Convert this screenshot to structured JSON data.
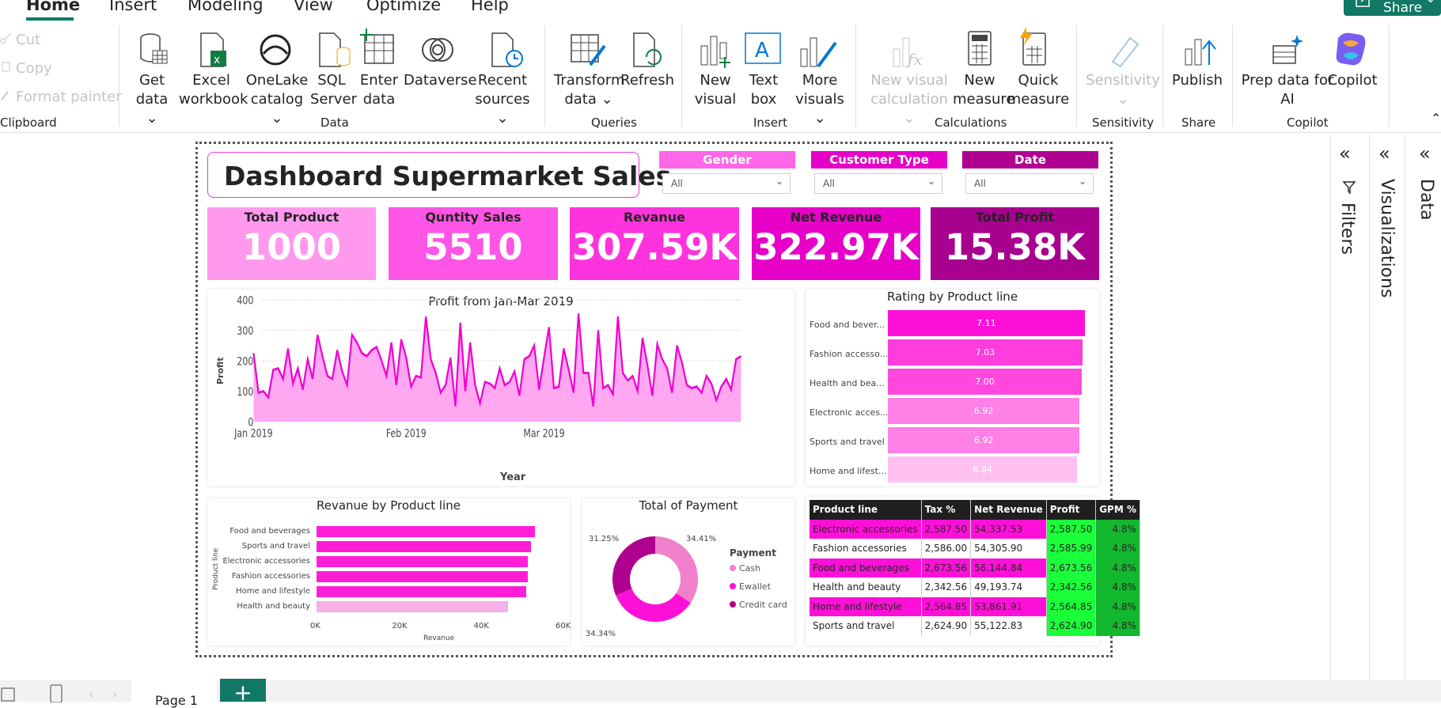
{
  "ribbon": {
    "tabs": [
      "Home",
      "Insert",
      "Modeling",
      "View",
      "Optimize",
      "Help"
    ],
    "share": "Share",
    "clipboard": {
      "cut": "Cut",
      "copy": "Copy",
      "format_painter": "Format painter",
      "group": "Clipboard"
    },
    "data_group": {
      "get_data": "Get",
      "get_data2": "data",
      "excel": "Excel",
      "excel2": "workbook",
      "onelake": "OneLake",
      "onelake2": "catalog",
      "sql": "SQL",
      "sql2": "Server",
      "enter": "Enter",
      "enter2": "data",
      "dataverse": "Dataverse",
      "recent": "Recent",
      "recent2": "sources",
      "group": "Data"
    },
    "queries": {
      "transform": "Transform",
      "transform2": "data",
      "refresh": "Refresh",
      "group": "Queries"
    },
    "insert": {
      "new_visual": "New",
      "new_visual2": "visual",
      "text_box": "Text",
      "text_box2": "box",
      "more_visuals": "More",
      "more_visuals2": "visuals",
      "group": "Insert"
    },
    "calc": {
      "new_visual_calc": "New visual",
      "new_visual_calc2": "calculation",
      "new_measure": "New",
      "new_measure2": "measure",
      "quick_measure": "Quick",
      "quick_measure2": "measure",
      "group": "Calculations"
    },
    "sensitivity": {
      "label": "Sensitivity",
      "group": "Sensitivity"
    },
    "share_group": {
      "publish": "Publish",
      "group": "Share"
    },
    "copilot": {
      "prep": "Prep data for",
      "prep2": "AI",
      "copilot": "Copilot",
      "group": "Copilot"
    }
  },
  "panes": {
    "filters": "Filters",
    "visualizations": "Visualizations",
    "data": "Data"
  },
  "page_tab": "Page 1",
  "dashboard": {
    "title": "Dashboard Supermarket Sales",
    "slicers": [
      {
        "label": "Gender",
        "value": "All"
      },
      {
        "label": "Customer Type",
        "value": "All"
      },
      {
        "label": "Date",
        "value": "All"
      }
    ],
    "kpis": [
      {
        "label": "Total Product",
        "value": "1000",
        "color": "#ff99ee"
      },
      {
        "label": "Quntity Sales",
        "value": "5510",
        "color": "#ff55e6"
      },
      {
        "label": "Revanue",
        "value": "307.59K",
        "color": "#ff33dd"
      },
      {
        "label": "Net Revenue",
        "value": "322.97K",
        "color": "#e600c8"
      },
      {
        "label": "Total Profit",
        "value": "15.38K",
        "color": "#a8008f"
      }
    ]
  },
  "chart_data": [
    {
      "type": "area",
      "title": "Profit from Jan-Mar 2019",
      "xlabel": "Year",
      "ylabel": "Profit",
      "ylim": [
        0,
        400
      ],
      "yticks": [
        "0",
        "100",
        "200",
        "300",
        "400"
      ],
      "xticks": [
        "Jan 2019",
        "Feb 2019",
        "Mar 2019"
      ],
      "values": [
        225,
        95,
        100,
        80,
        170,
        175,
        140,
        240,
        125,
        175,
        105,
        205,
        140,
        285,
        215,
        150,
        140,
        235,
        165,
        120,
        285,
        260,
        225,
        215,
        235,
        245,
        200,
        150,
        260,
        120,
        270,
        210,
        115,
        150,
        145,
        345,
        205,
        160,
        95,
        120,
        210,
        50,
        325,
        100,
        260,
        120,
        60,
        130,
        125,
        110,
        175,
        120,
        130,
        165,
        85,
        205,
        215,
        250,
        105,
        210,
        310,
        110,
        115,
        240,
        170,
        95,
        355,
        160,
        160,
        50,
        300,
        110,
        120,
        90,
        345,
        160,
        135,
        150,
        100,
        275,
        185,
        85,
        255,
        205,
        175,
        95,
        250,
        195,
        120,
        110,
        115,
        95,
        150,
        125,
        70,
        115,
        140,
        105,
        205,
        215
      ]
    },
    {
      "type": "bar",
      "title": "Rating by Product line",
      "categories": [
        "Food and bever...",
        "Fashion accesso...",
        "Health and bea...",
        "Electronic acces...",
        "Sports and travel",
        "Home and lifest..."
      ],
      "values": [
        7.11,
        7.03,
        7.0,
        6.92,
        6.92,
        6.84
      ],
      "labels": [
        "7.11",
        "7.03",
        "7.00",
        "6.92",
        "6.92",
        "6.84"
      ],
      "colors": [
        "#ff10d8",
        "#ff3cdc",
        "#ff48de",
        "#ff80e6",
        "#ff80e6",
        "#ffc0f0"
      ]
    },
    {
      "type": "bar",
      "title": "Revanue by Product line",
      "xlabel": "Revanue",
      "ylabel": "Product line",
      "categories": [
        "Food and beverages",
        "Sports and travel",
        "Electronic accessories",
        "Fashion accessories",
        "Home and lifestyle",
        "Health and beauty"
      ],
      "values": [
        53471,
        52497,
        51750,
        51719,
        51297,
        46851
      ],
      "xticks": [
        "0K",
        "20K",
        "40K",
        "60K"
      ],
      "xlim": [
        0,
        60000
      ],
      "colors": [
        "#ff1ed8",
        "#ff1ed8",
        "#ff1ed8",
        "#ff1ed8",
        "#ff1ed8",
        "#f5b0e6"
      ]
    },
    {
      "type": "pie",
      "title": "Total of Payment",
      "legend_title": "Payment",
      "series": [
        {
          "name": "Cash",
          "value": 34.41,
          "label": "34.41%",
          "color": "#f080cc"
        },
        {
          "name": "Ewallet",
          "value": 34.34,
          "label": "34.34%",
          "color": "#ff10d8"
        },
        {
          "name": "Credit card",
          "value": 31.25,
          "label": "31.25%",
          "color": "#b0008f"
        }
      ]
    },
    {
      "type": "table",
      "columns": [
        "Product line",
        "Tax %",
        "Net Revenue",
        "Profit",
        "GPM %"
      ],
      "rows": [
        [
          "Electronic accessories",
          "2,587.50",
          "54,337.53",
          "2,587.50",
          "4.8%"
        ],
        [
          "Fashion accessories",
          "2,586.00",
          "54,305.90",
          "2,585.99",
          "4.8%"
        ],
        [
          "Food and beverages",
          "2,673.56",
          "56,144.84",
          "2,673.56",
          "4.8%"
        ],
        [
          "Health and beauty",
          "2,342.56",
          "49,193.74",
          "2,342.56",
          "4.8%"
        ],
        [
          "Home and lifestyle",
          "2,564.85",
          "53,861.91",
          "2,564.85",
          "4.8%"
        ],
        [
          "Sports and travel",
          "2,624.90",
          "55,122.83",
          "2,624.90",
          "4.8%"
        ]
      ],
      "highlight_rows": [
        0,
        2,
        4
      ]
    }
  ]
}
